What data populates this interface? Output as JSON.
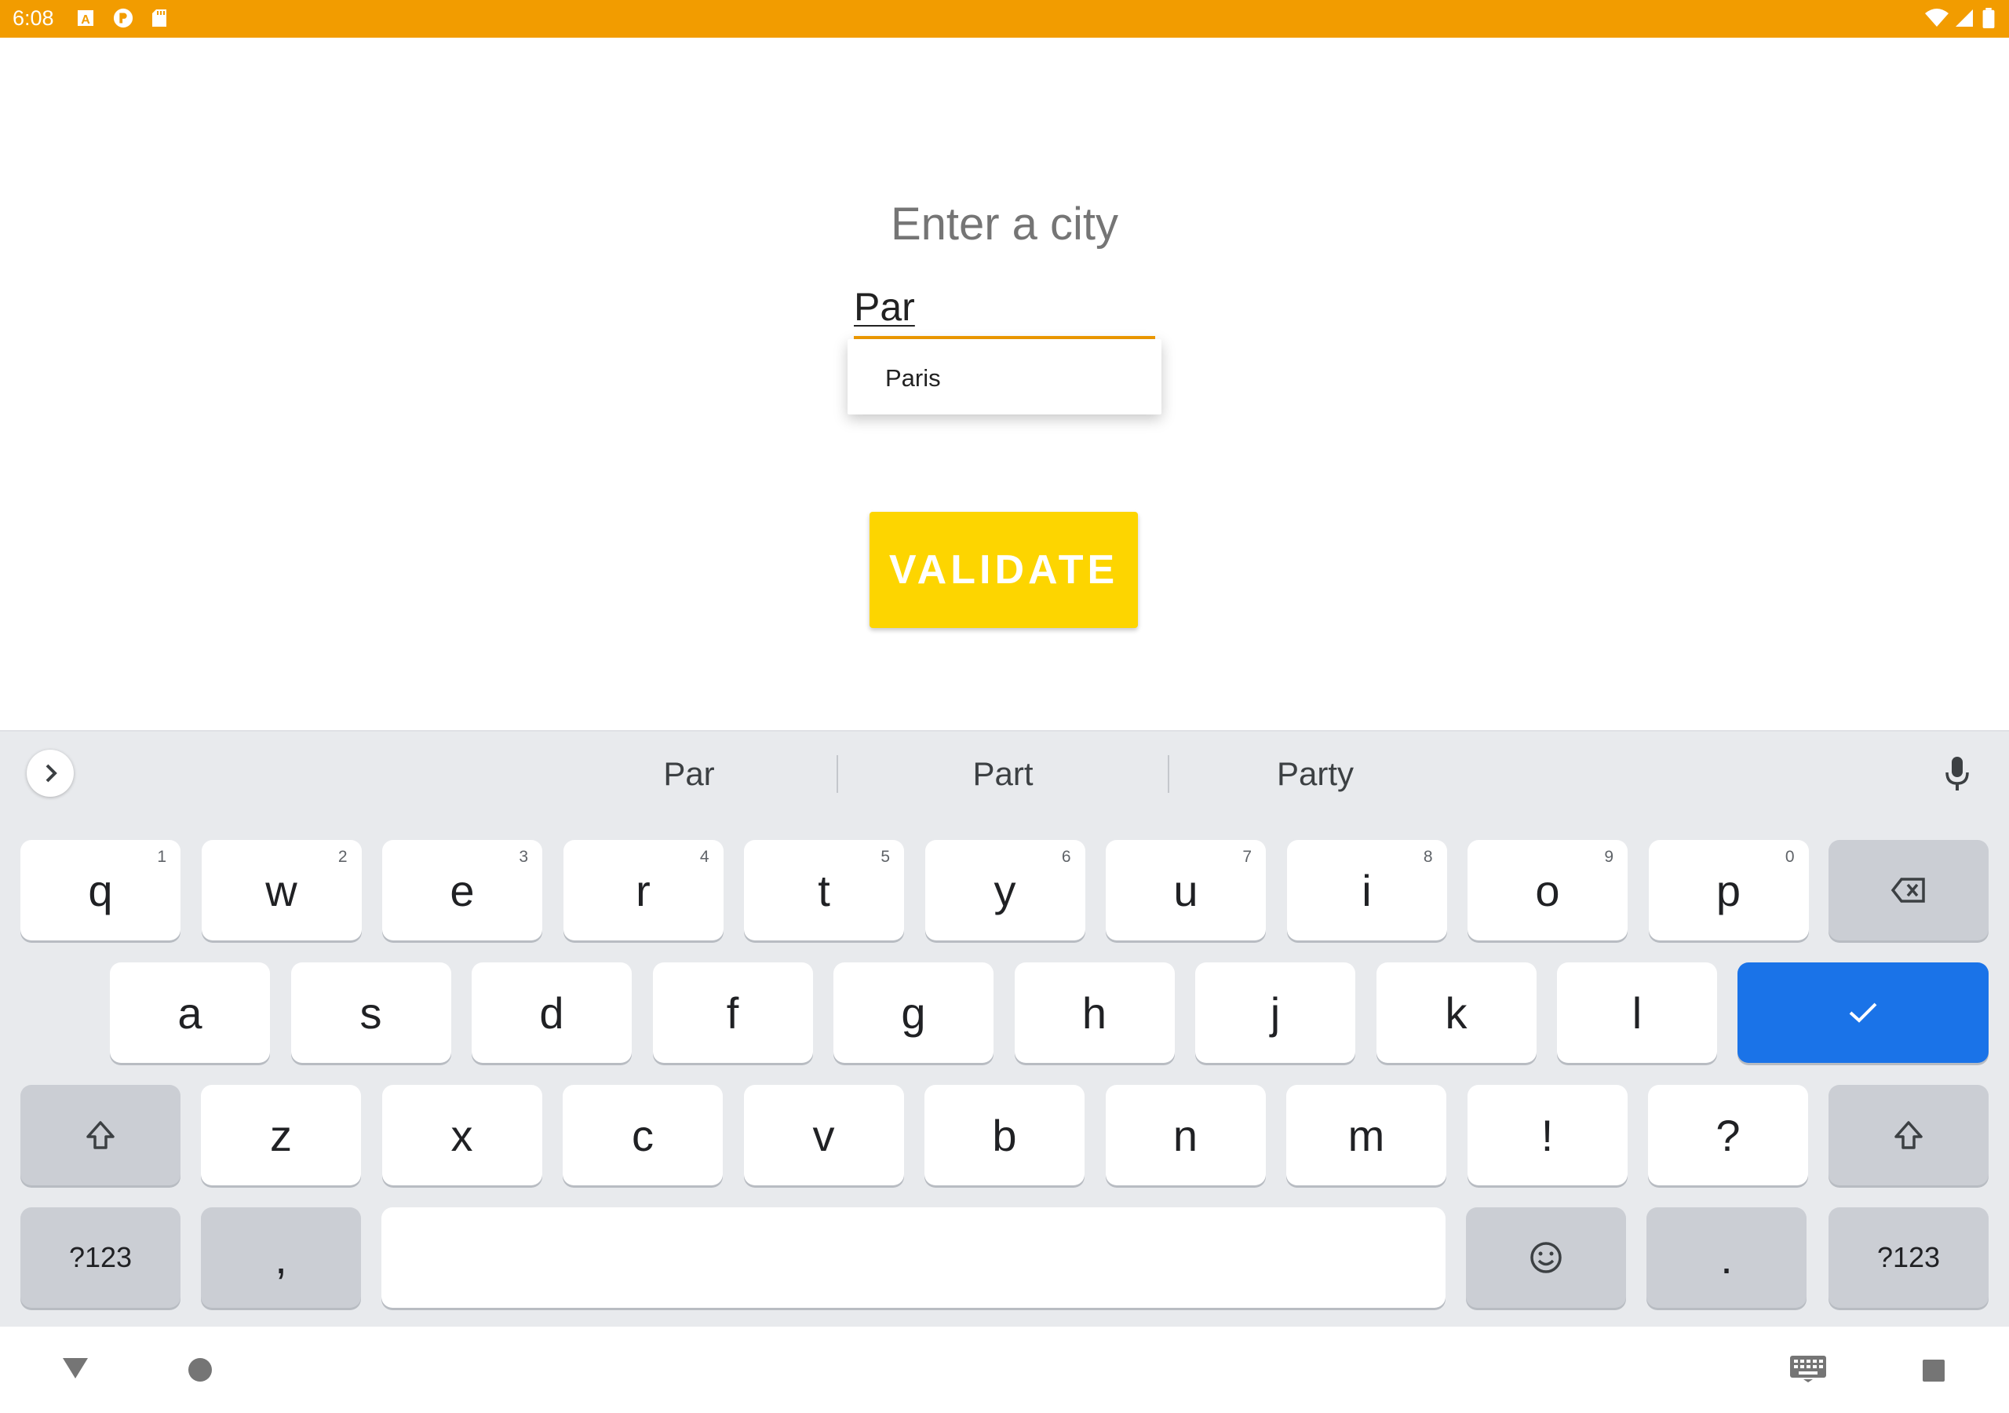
{
  "status_bar": {
    "time": "6:08",
    "left_icons": [
      "text-format-icon",
      "app-icon",
      "sd-card-icon"
    ],
    "right_icons": [
      "wifi-icon",
      "signal-icon",
      "battery-icon"
    ]
  },
  "app": {
    "title": "Enter a city",
    "city_input": {
      "value": "Par"
    },
    "autocomplete": [
      "Paris"
    ],
    "validate_label": "VALIDATE",
    "colors": {
      "accent": "#f29c00",
      "button": "#fdd500"
    }
  },
  "keyboard": {
    "suggestions": [
      "Par",
      "Part",
      "Party"
    ],
    "row1": [
      {
        "k": "q",
        "h": "1"
      },
      {
        "k": "w",
        "h": "2"
      },
      {
        "k": "e",
        "h": "3"
      },
      {
        "k": "r",
        "h": "4"
      },
      {
        "k": "t",
        "h": "5"
      },
      {
        "k": "y",
        "h": "6"
      },
      {
        "k": "u",
        "h": "7"
      },
      {
        "k": "i",
        "h": "8"
      },
      {
        "k": "o",
        "h": "9"
      },
      {
        "k": "p",
        "h": "0"
      }
    ],
    "row2": [
      "a",
      "s",
      "d",
      "f",
      "g",
      "h",
      "j",
      "k",
      "l"
    ],
    "row3": [
      "z",
      "x",
      "c",
      "v",
      "b",
      "n",
      "m",
      "!",
      "?"
    ],
    "symbols_label": "?123",
    "comma": ",",
    "period": ".",
    "enter_color": "#1a73e8"
  }
}
